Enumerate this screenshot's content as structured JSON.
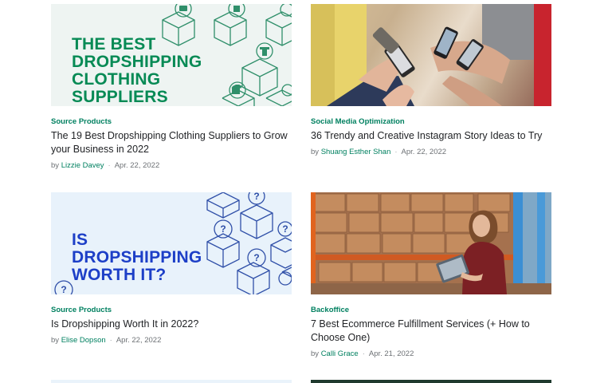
{
  "articles": [
    {
      "thumb_text": [
        "THE BEST",
        "DROPSHIPPING",
        "CLOTHING",
        "SUPPLIERS"
      ],
      "category": "Source Products",
      "title": "The 19 Best Dropshipping Clothing Suppliers to Grow your Business in 2022",
      "by": "by",
      "author": "Lizzie Davey",
      "date": "Apr. 22, 2022"
    },
    {
      "category": "Social Media Optimization",
      "title": "36 Trendy and Creative Instagram Story Ideas to Try",
      "by": "by",
      "author": "Shuang Esther Shan",
      "date": "Apr. 22, 2022"
    },
    {
      "thumb_text": [
        "IS",
        "DROPSHIPPING",
        "WORTH IT?"
      ],
      "category": "Source Products",
      "title": "Is Dropshipping Worth It in 2022?",
      "by": "by",
      "author": "Elise Dopson",
      "date": "Apr. 22, 2022"
    },
    {
      "category": "Backoffice",
      "title": "7 Best Ecommerce Fulfillment Services (+ How to Choose One)",
      "by": "by",
      "author": "Calli Grace",
      "date": "Apr. 21, 2022"
    }
  ],
  "separator": "·",
  "colors": {
    "category_green": "#008060",
    "thumb_green_text": "#078a55",
    "thumb_blue_text": "#1d3fc7",
    "meta_gray": "#6d7175"
  }
}
